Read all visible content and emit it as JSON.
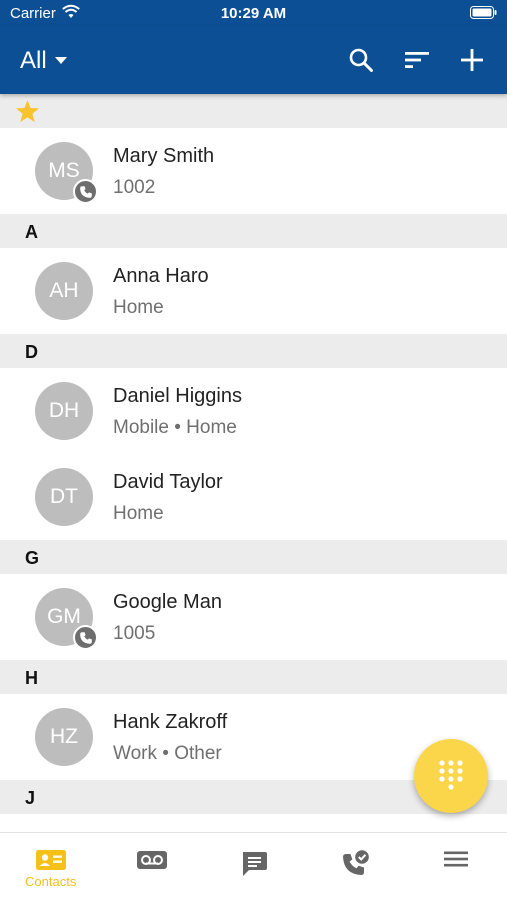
{
  "status_bar": {
    "carrier": "Carrier",
    "time": "10:29 AM"
  },
  "app_bar": {
    "filter_label": "All"
  },
  "sections": [
    {
      "letter": "",
      "favorites": true,
      "contacts": [
        {
          "initials": "MS",
          "name": "Mary Smith",
          "detail": "1002",
          "phone_badge": true
        }
      ]
    },
    {
      "letter": "A",
      "contacts": [
        {
          "initials": "AH",
          "name": "Anna Haro",
          "detail": "Home",
          "phone_badge": false
        }
      ]
    },
    {
      "letter": "D",
      "contacts": [
        {
          "initials": "DH",
          "name": "Daniel Higgins",
          "detail": "Mobile • Home",
          "phone_badge": false
        },
        {
          "initials": "DT",
          "name": "David Taylor",
          "detail": "Home",
          "phone_badge": false
        }
      ]
    },
    {
      "letter": "G",
      "contacts": [
        {
          "initials": "GM",
          "name": "Google Man",
          "detail": "1005",
          "phone_badge": true
        }
      ]
    },
    {
      "letter": "H",
      "contacts": [
        {
          "initials": "HZ",
          "name": "Hank Zakroff",
          "detail": "Work • Other",
          "phone_badge": false
        }
      ]
    },
    {
      "letter": "J",
      "contacts": []
    }
  ],
  "tab_bar": {
    "tabs": [
      {
        "icon": "contacts-card-icon",
        "label": "Contacts",
        "active": true
      },
      {
        "icon": "voicemail-icon",
        "label": "",
        "active": false
      },
      {
        "icon": "message-icon",
        "label": "",
        "active": false
      },
      {
        "icon": "call-history-icon",
        "label": "",
        "active": false
      },
      {
        "icon": "menu-icon",
        "label": "",
        "active": false
      }
    ]
  },
  "colors": {
    "primary": "#0d4f94",
    "accent": "#fbd64b",
    "avatar": "#bdbdbd",
    "section_bg": "#ececec"
  }
}
